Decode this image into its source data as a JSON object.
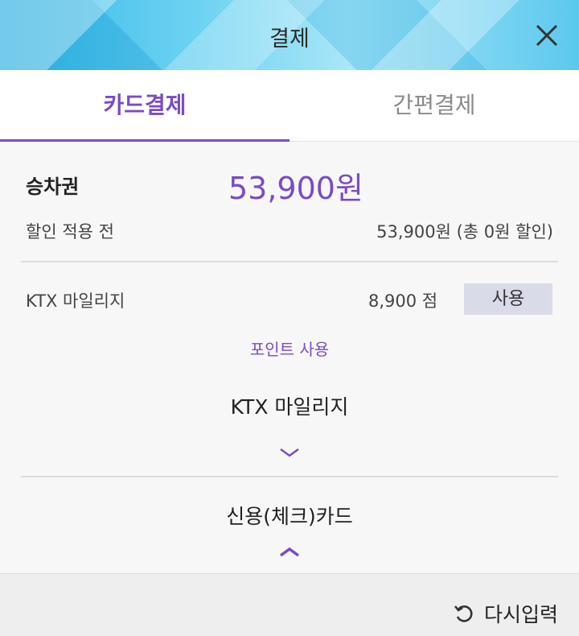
{
  "header": {
    "title": "결제",
    "close_icon": "close-icon"
  },
  "tabs": [
    {
      "label": "카드결제",
      "active": true
    },
    {
      "label": "간편결제",
      "active": false
    }
  ],
  "fare": {
    "label": "승차권",
    "amount": "53,900원"
  },
  "discount": {
    "label": "할인 적용 전",
    "value": "53,900원 (총 0원 할인)"
  },
  "mileage": {
    "label": "KTX 마일리지",
    "points": "8,900 점",
    "use_button": "사용"
  },
  "points_link": "포인트 사용",
  "sections": {
    "mileage_title": "KTX 마일리지",
    "card_title": "신용(체크)카드"
  },
  "footer": {
    "reset_label": "다시입력",
    "reset_icon": "refresh-icon"
  },
  "colors": {
    "accent": "#7b4bc4",
    "use_button_bg": "#d9dbe8",
    "header_blue": "#34b8e8"
  }
}
